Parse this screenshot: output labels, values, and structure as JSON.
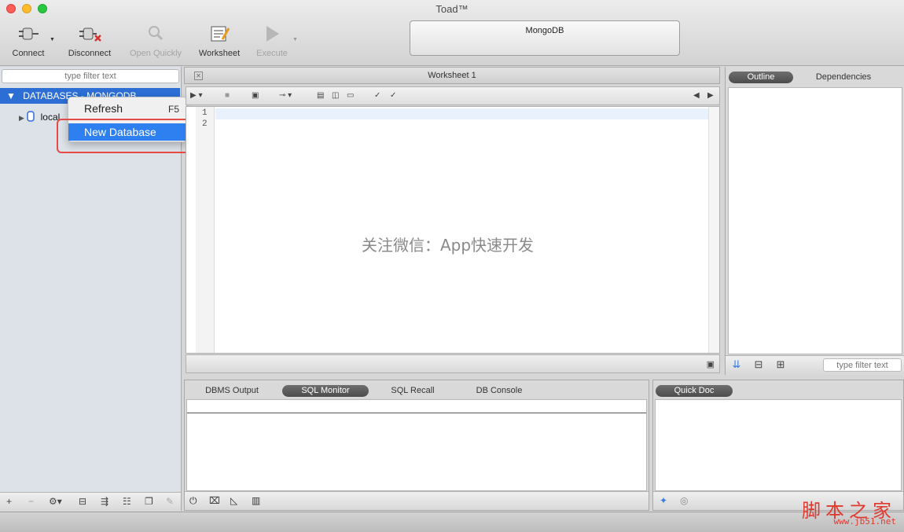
{
  "window": {
    "title": "Toad™"
  },
  "toolbar": {
    "connect": "Connect",
    "disconnect": "Disconnect",
    "open_quickly": "Open Quickly",
    "worksheet": "Worksheet",
    "execute": "Execute"
  },
  "connection": {
    "name": "MongoDB"
  },
  "left_panel": {
    "filter_placeholder": "type filter text",
    "tree_header": "DATABASES - MONGODB",
    "tree_items": [
      "local"
    ]
  },
  "context_menu": {
    "items": [
      {
        "label": "Refresh",
        "shortcut": "F5",
        "selected": false
      },
      {
        "label": "New Database",
        "shortcut": "",
        "selected": true
      }
    ]
  },
  "worksheet": {
    "tab_label": "Worksheet 1",
    "line_numbers": [
      "1",
      "2"
    ],
    "watermark": "关注微信：App快速开发"
  },
  "right_panel": {
    "tabs": [
      "Outline",
      "Dependencies"
    ],
    "active_tab": "Outline",
    "filter_placeholder": "type filter text"
  },
  "bottom_panel": {
    "tabs": [
      "DBMS Output",
      "SQL Monitor",
      "SQL Recall",
      "DB Console"
    ],
    "active_tab": "SQL Monitor"
  },
  "quick_doc": {
    "tab": "Quick Doc"
  },
  "site_watermark": {
    "text": "脚本之家",
    "url": "www.jb51.net"
  },
  "colors": {
    "selection": "#2c6ed4",
    "menu_highlight": "#2e7ff0",
    "annotation_box": "#e54a44"
  }
}
